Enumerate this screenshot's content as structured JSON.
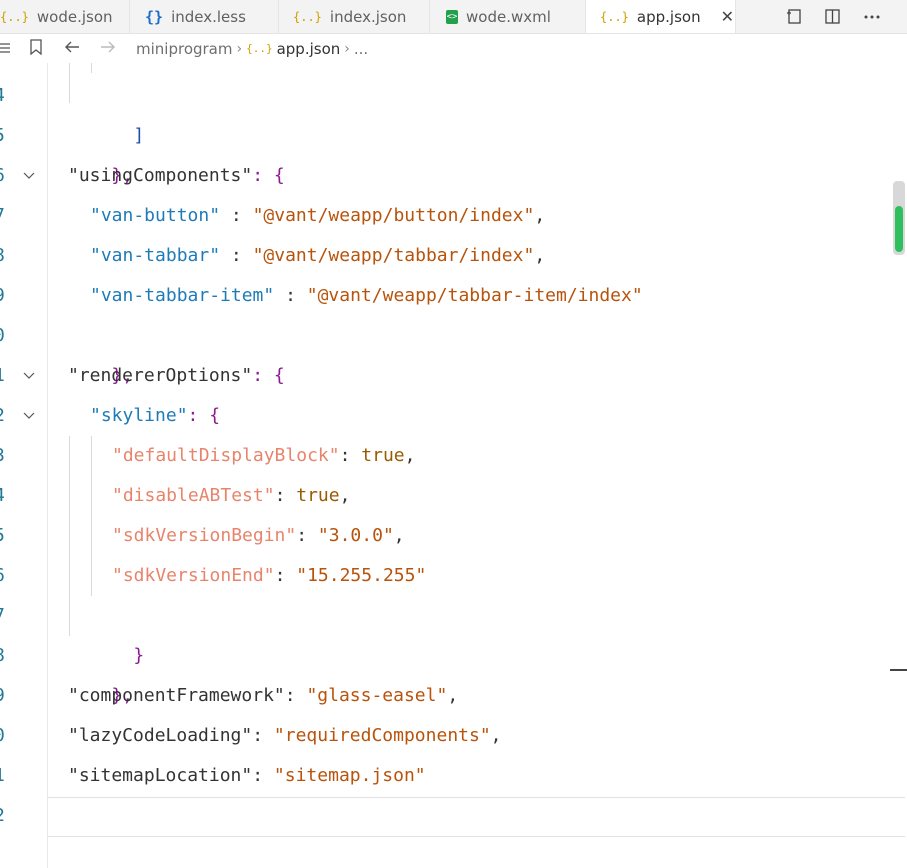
{
  "tabs": [
    {
      "label": "wode.json",
      "icon": "json-braces-icon",
      "active": false
    },
    {
      "label": "index.less",
      "icon": "less-braces-icon",
      "active": false
    },
    {
      "label": "index.json",
      "icon": "json-braces-icon",
      "active": false
    },
    {
      "label": "wode.wxml",
      "icon": "wxml-file-icon",
      "active": false
    },
    {
      "label": "app.json",
      "icon": "json-braces-icon",
      "active": true
    }
  ],
  "tab_close_glyph": "✕",
  "breadcrumb": {
    "root": "miniprogram",
    "file": "app.json",
    "more": "..."
  },
  "editor": {
    "line_numbers": [
      "4",
      "5",
      "6",
      "7",
      "8",
      "9",
      "0",
      "1",
      "2",
      "3",
      "4",
      "5",
      "6",
      "7",
      "8",
      "9",
      "0",
      "1",
      "2"
    ],
    "code": {
      "l44": "]",
      "l45": "},",
      "l46_key": "\"usingComponents\"",
      "l46_rest": ": {",
      "l47_key": "\"van-button\"",
      "l47_sep": " : ",
      "l47_val": "\"@vant/weapp/button/index\"",
      "l47_end": ",",
      "l48_key": "\"van-tabbar\"",
      "l48_sep": " : ",
      "l48_val": "\"@vant/weapp/tabbar/index\"",
      "l48_end": ",",
      "l49_key": "\"van-tabbar-item\"",
      "l49_sep": " : ",
      "l49_val": "\"@vant/weapp/tabbar-item/index\"",
      "l50": "},",
      "l51_key": "\"rendererOptions\"",
      "l51_rest": ": {",
      "l52_key": "\"skyline\"",
      "l52_rest": ": {",
      "l53_key": "\"defaultDisplayBlock\"",
      "l53_val": "true",
      "l54_key": "\"disableABTest\"",
      "l54_val": "true",
      "l55_key": "\"sdkVersionBegin\"",
      "l55_val": "\"3.0.0\"",
      "l56_key": "\"sdkVersionEnd\"",
      "l56_val": "\"15.255.255\"",
      "l57": "}",
      "l58": "},",
      "l59_key": "\"componentFramework\"",
      "l59_val": "\"glass-easel\"",
      "l60_key": "\"lazyCodeLoading\"",
      "l60_val": "\"requiredComponents\"",
      "l61_key": "\"sitemapLocation\"",
      "l61_val": "\"sitemap.json\"",
      "l63": "}"
    }
  },
  "colors": {
    "line_number": "#237893",
    "string": "#b8530b",
    "key_blue": "#1e7bb8",
    "key_salmon": "#e8846b",
    "bracket": "#8b1a94",
    "scroll_green": "#2fbf5f"
  }
}
